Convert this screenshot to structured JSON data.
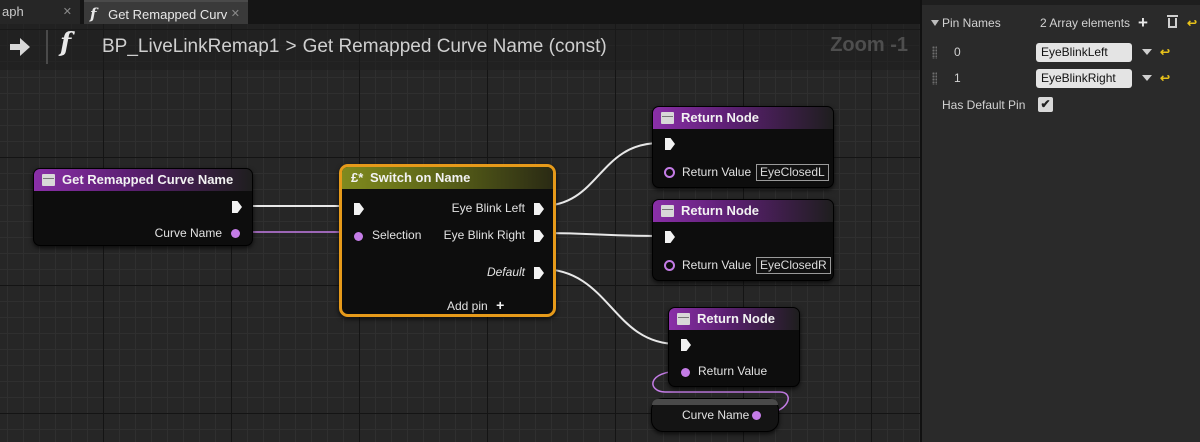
{
  "tabs": [
    {
      "label": "aph"
    },
    {
      "label": "Get Remapped Curv",
      "icon": "function-icon"
    }
  ],
  "breadcrumb": {
    "func_symbol": "f",
    "blueprint": "BP_LiveLinkRemap1",
    "separator": ">",
    "function": "Get Remapped Curve Name (const)"
  },
  "zoom_label": "Zoom -1",
  "nodes": {
    "entry": {
      "title": "Get Remapped Curve Name",
      "output_label": "Curve Name"
    },
    "switch": {
      "icon": "£*",
      "title": "Switch on Name",
      "selection_label": "Selection",
      "out1": "Eye Blink Left",
      "out2": "Eye Blink Right",
      "default": "Default",
      "add_pin": "Add pin",
      "add_pin_icon": "+"
    },
    "return1": {
      "title": "Return Node",
      "value_label": "Return Value",
      "value": "EyeClosedL"
    },
    "return2": {
      "title": "Return Node",
      "value_label": "Return Value",
      "value": "EyeClosedR"
    },
    "return3": {
      "title": "Return Node",
      "value_label": "Return Value"
    },
    "curve_name": {
      "label": "Curve Name"
    }
  },
  "details": {
    "pin_names_label": "Pin Names",
    "array_label": "2 Array elements",
    "add_icon": "+",
    "elements": [
      {
        "index": "0",
        "value": "EyeBlinkLeft"
      },
      {
        "index": "1",
        "value": "EyeBlinkRight"
      }
    ],
    "reset_icon": "↩",
    "has_default_label": "Has Default Pin",
    "has_default_checked": true,
    "check_mark": "✔"
  },
  "colors": {
    "pin_purple": "#c47ce6",
    "selection_orange": "#e69a1a",
    "function_header": "#8a2fa8",
    "switch_header": "#808a1e"
  }
}
